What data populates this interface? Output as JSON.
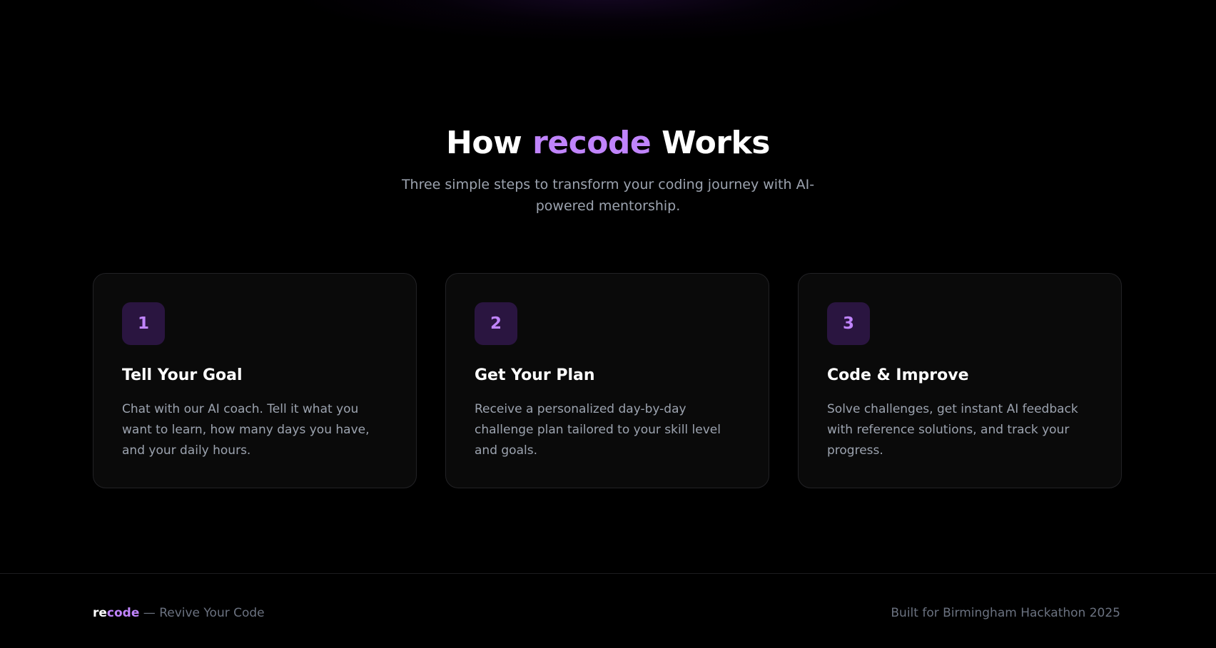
{
  "hero": {
    "heading_pre": "How ",
    "heading_accent": "recode",
    "heading_post": " Works",
    "subtitle": "Three simple steps to transform your coding journey with AI-powered mentorship."
  },
  "steps": [
    {
      "number": "1",
      "title": "Tell Your Goal",
      "description": "Chat with our AI coach. Tell it what you want to learn, how many days you have, and your daily hours."
    },
    {
      "number": "2",
      "title": "Get Your Plan",
      "description": "Receive a personalized day-by-day challenge plan tailored to your skill level and goals."
    },
    {
      "number": "3",
      "title": "Code & Improve",
      "description": "Solve challenges, get instant AI feedback with reference solutions, and track your progress."
    }
  ],
  "footer": {
    "brand_re": "re",
    "brand_code": "code",
    "tagline": " — Revive Your Code",
    "credit": "Built for Birmingham Hackathon 2025"
  },
  "colors": {
    "accent": "#c084fc",
    "background": "#000000",
    "card_bg": "#0a0a0a",
    "badge_bg": "#2a1540",
    "muted_text": "#9ca3af"
  }
}
